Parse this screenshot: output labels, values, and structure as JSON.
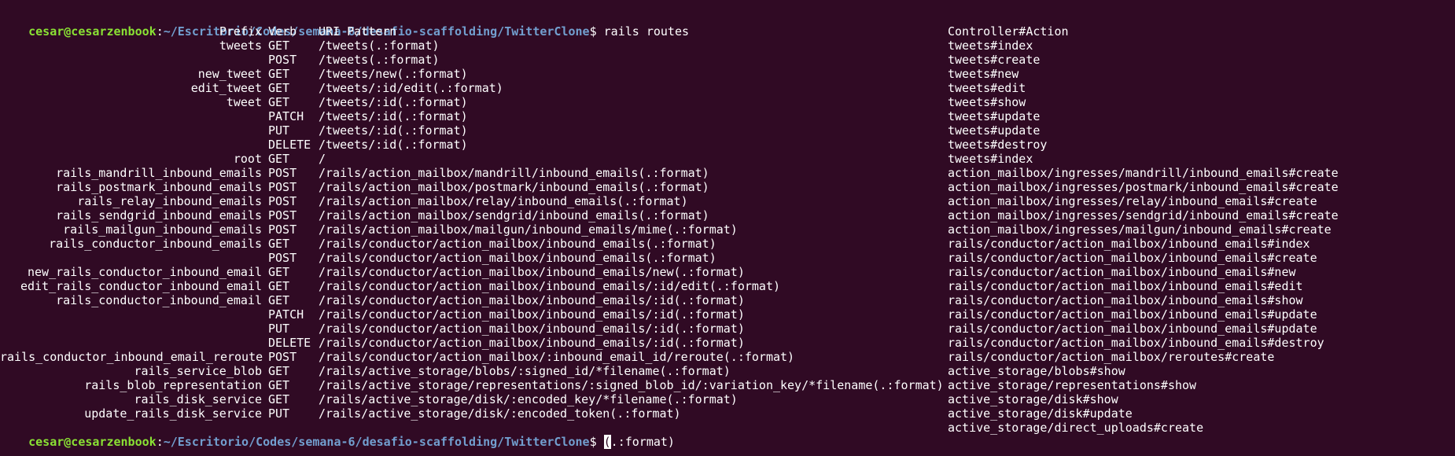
{
  "prompt": {
    "user_host": "cesar@cesarzenbook",
    "separator": ":",
    "path": "~/Escritorio/Codes/semana-6/desafio-scaffolding/TwitterClone",
    "symbol": "$ "
  },
  "command": "rails routes",
  "header": {
    "prefix": "Prefix",
    "verb": "Verb",
    "uri": "URI Pattern",
    "action": "Controller#Action"
  },
  "routes": [
    {
      "prefix": "tweets",
      "verb": "GET",
      "uri": "/tweets(.:format)",
      "action": "tweets#index"
    },
    {
      "prefix": "",
      "verb": "POST",
      "uri": "/tweets(.:format)",
      "action": "tweets#create"
    },
    {
      "prefix": "new_tweet",
      "verb": "GET",
      "uri": "/tweets/new(.:format)",
      "action": "tweets#new"
    },
    {
      "prefix": "edit_tweet",
      "verb": "GET",
      "uri": "/tweets/:id/edit(.:format)",
      "action": "tweets#edit"
    },
    {
      "prefix": "tweet",
      "verb": "GET",
      "uri": "/tweets/:id(.:format)",
      "action": "tweets#show"
    },
    {
      "prefix": "",
      "verb": "PATCH",
      "uri": "/tweets/:id(.:format)",
      "action": "tweets#update"
    },
    {
      "prefix": "",
      "verb": "PUT",
      "uri": "/tweets/:id(.:format)",
      "action": "tweets#update"
    },
    {
      "prefix": "",
      "verb": "DELETE",
      "uri": "/tweets/:id(.:format)",
      "action": "tweets#destroy"
    },
    {
      "prefix": "root",
      "verb": "GET",
      "uri": "/",
      "action": "tweets#index"
    },
    {
      "prefix": "rails_mandrill_inbound_emails",
      "verb": "POST",
      "uri": "/rails/action_mailbox/mandrill/inbound_emails(.:format)",
      "action": "action_mailbox/ingresses/mandrill/inbound_emails#create"
    },
    {
      "prefix": "rails_postmark_inbound_emails",
      "verb": "POST",
      "uri": "/rails/action_mailbox/postmark/inbound_emails(.:format)",
      "action": "action_mailbox/ingresses/postmark/inbound_emails#create"
    },
    {
      "prefix": "rails_relay_inbound_emails",
      "verb": "POST",
      "uri": "/rails/action_mailbox/relay/inbound_emails(.:format)",
      "action": "action_mailbox/ingresses/relay/inbound_emails#create"
    },
    {
      "prefix": "rails_sendgrid_inbound_emails",
      "verb": "POST",
      "uri": "/rails/action_mailbox/sendgrid/inbound_emails(.:format)",
      "action": "action_mailbox/ingresses/sendgrid/inbound_emails#create"
    },
    {
      "prefix": "rails_mailgun_inbound_emails",
      "verb": "POST",
      "uri": "/rails/action_mailbox/mailgun/inbound_emails/mime(.:format)",
      "action": "action_mailbox/ingresses/mailgun/inbound_emails#create"
    },
    {
      "prefix": "rails_conductor_inbound_emails",
      "verb": "GET",
      "uri": "/rails/conductor/action_mailbox/inbound_emails(.:format)",
      "action": "rails/conductor/action_mailbox/inbound_emails#index"
    },
    {
      "prefix": "",
      "verb": "POST",
      "uri": "/rails/conductor/action_mailbox/inbound_emails(.:format)",
      "action": "rails/conductor/action_mailbox/inbound_emails#create"
    },
    {
      "prefix": "new_rails_conductor_inbound_email",
      "verb": "GET",
      "uri": "/rails/conductor/action_mailbox/inbound_emails/new(.:format)",
      "action": "rails/conductor/action_mailbox/inbound_emails#new"
    },
    {
      "prefix": "edit_rails_conductor_inbound_email",
      "verb": "GET",
      "uri": "/rails/conductor/action_mailbox/inbound_emails/:id/edit(.:format)",
      "action": "rails/conductor/action_mailbox/inbound_emails#edit"
    },
    {
      "prefix": "rails_conductor_inbound_email",
      "verb": "GET",
      "uri": "/rails/conductor/action_mailbox/inbound_emails/:id(.:format)",
      "action": "rails/conductor/action_mailbox/inbound_emails#show"
    },
    {
      "prefix": "",
      "verb": "PATCH",
      "uri": "/rails/conductor/action_mailbox/inbound_emails/:id(.:format)",
      "action": "rails/conductor/action_mailbox/inbound_emails#update"
    },
    {
      "prefix": "",
      "verb": "PUT",
      "uri": "/rails/conductor/action_mailbox/inbound_emails/:id(.:format)",
      "action": "rails/conductor/action_mailbox/inbound_emails#update"
    },
    {
      "prefix": "",
      "verb": "DELETE",
      "uri": "/rails/conductor/action_mailbox/inbound_emails/:id(.:format)",
      "action": "rails/conductor/action_mailbox/inbound_emails#destroy"
    },
    {
      "prefix": "rails_conductor_inbound_email_reroute",
      "verb": "POST",
      "uri": "/rails/conductor/action_mailbox/:inbound_email_id/reroute(.:format)",
      "action": "rails/conductor/action_mailbox/reroutes#create"
    },
    {
      "prefix": "rails_service_blob",
      "verb": "GET",
      "uri": "/rails/active_storage/blobs/:signed_id/*filename(.:format)",
      "action": "active_storage/blobs#show"
    },
    {
      "prefix": "rails_blob_representation",
      "verb": "GET",
      "uri": "/rails/active_storage/representations/:signed_blob_id/:variation_key/*filename(.:format)",
      "action": "active_storage/representations#show"
    },
    {
      "prefix": "rails_disk_service",
      "verb": "GET",
      "uri": "/rails/active_storage/disk/:encoded_key/*filename(.:format)",
      "action": "active_storage/disk#show"
    },
    {
      "prefix": "update_rails_disk_service",
      "verb": "PUT",
      "uri": "/rails/active_storage/disk/:encoded_token(.:format)",
      "action": "active_storage/disk#update"
    }
  ],
  "last_line": {
    "cursor_char": "(",
    "rest": ".:format)",
    "action": "active_storage/direct_uploads#create"
  },
  "colors": {
    "background": "#300a24",
    "prompt_user": "#8ae234",
    "prompt_path": "#729fcf",
    "text": "#ffffff"
  }
}
